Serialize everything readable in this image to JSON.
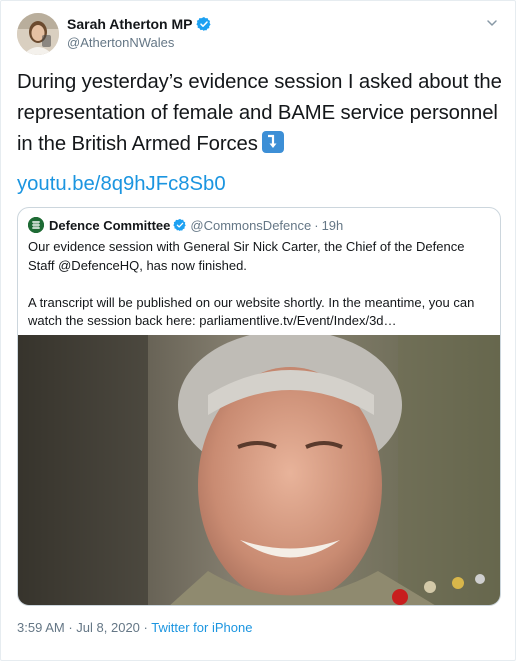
{
  "author": {
    "name": "Sarah Atherton MP",
    "handle": "@AthertonNWales"
  },
  "tweet": {
    "text": "During yesterday’s evidence session I asked about the representation of female and BAME service personnel in the British Armed Forces",
    "emoji": "arrow-down-right-emoji",
    "link": "youtu.be/8q9hJFc8Sb0"
  },
  "quoted": {
    "name": "Defence Committee",
    "handle": "@CommonsDefence",
    "separator": "·",
    "time": "19h",
    "paragraph1": "Our evidence session with General Sir Nick Carter, the Chief of the Defence Staff @DefenceHQ, has now finished.",
    "paragraph2": "A transcript will be published on our website shortly. In the meantime, you can watch the session back here: parliamentlive.tv/Event/Index/3d…",
    "image": "photo of a smiling grey-haired man in military uniform"
  },
  "meta": {
    "time": "3:59 AM",
    "sep1": "·",
    "date": "Jul 8, 2020",
    "sep2": "·",
    "source": "Twitter for iPhone"
  },
  "colors": {
    "verified": "#1da1f2",
    "link": "#1b95e0",
    "secondary": "#657786"
  }
}
